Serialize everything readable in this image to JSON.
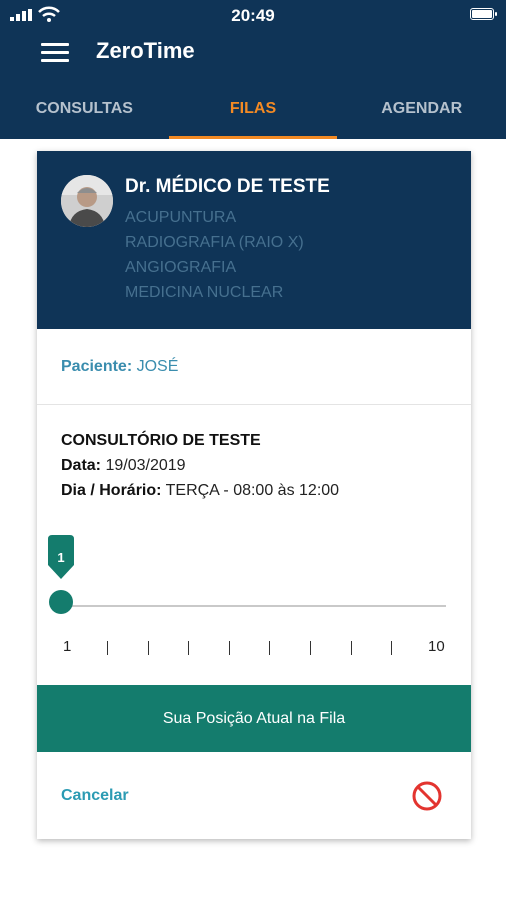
{
  "status_bar": {
    "time": "20:49"
  },
  "header": {
    "app_title": "ZeroTime"
  },
  "tabs": [
    {
      "label": "CONSULTAS",
      "active": false
    },
    {
      "label": "FILAS",
      "active": true
    },
    {
      "label": "AGENDAR",
      "active": false
    }
  ],
  "card": {
    "doctor_name": "Dr. MÉDICO DE TESTE",
    "specialties": [
      "ACUPUNTURA",
      "RADIOGRAFIA (RAIO X)",
      "ANGIOGRAFIA",
      "MEDICINA NUCLEAR"
    ],
    "patient_label": "Paciente:",
    "patient_name": "JOSÉ",
    "office_name": "CONSULTÓRIO DE TESTE",
    "date_label": "Data:",
    "date_value": "19/03/2019",
    "schedule_label": "Dia / Horário:",
    "schedule_value": "TERÇA - 08:00 às 12:00",
    "slider": {
      "value": "1",
      "min": "1",
      "max": "10"
    },
    "position_button": "Sua Posição Atual na Fila",
    "cancel_label": "Cancelar"
  },
  "colors": {
    "primary": "#0f3457",
    "accent": "#f38a24",
    "teal": "#147c6d",
    "link": "#2b9bb3",
    "danger": "#e3342f"
  },
  "icons": [
    "menu-icon",
    "signal-icon",
    "wifi-icon",
    "battery-icon",
    "ban-icon"
  ]
}
